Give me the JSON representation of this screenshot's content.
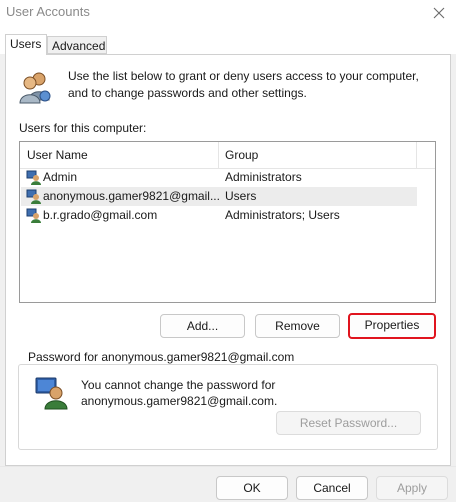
{
  "window": {
    "title": "User Accounts"
  },
  "tabs": [
    {
      "label": "Users",
      "selected": true
    },
    {
      "label": "Advanced",
      "selected": false
    }
  ],
  "intro": {
    "line1": "Use the list below to grant or deny users access to your computer,",
    "line2": "and to change passwords and other settings."
  },
  "users_list": {
    "label": "Users for this computer:",
    "columns": [
      "User Name",
      "Group"
    ],
    "rows": [
      {
        "name": "Admin",
        "group": "Administrators",
        "selected": false
      },
      {
        "name": "anonymous.gamer9821@gmail....",
        "group": "Users",
        "selected": true
      },
      {
        "name": "b.r.grado@gmail.com",
        "group": "Administrators; Users",
        "selected": false
      }
    ]
  },
  "buttons": {
    "add": "Add...",
    "remove": "Remove",
    "properties": "Properties"
  },
  "password": {
    "legend": "Password for anonymous.gamer9821@gmail.com",
    "line1": "You cannot change the password for",
    "line2": "anonymous.gamer9821@gmail.com.",
    "reset": "Reset Password..."
  },
  "footer": {
    "ok": "OK",
    "cancel": "Cancel",
    "apply": "Apply"
  },
  "colors": {
    "highlight_border": "#e0141e",
    "selected_row": "#ececec"
  }
}
